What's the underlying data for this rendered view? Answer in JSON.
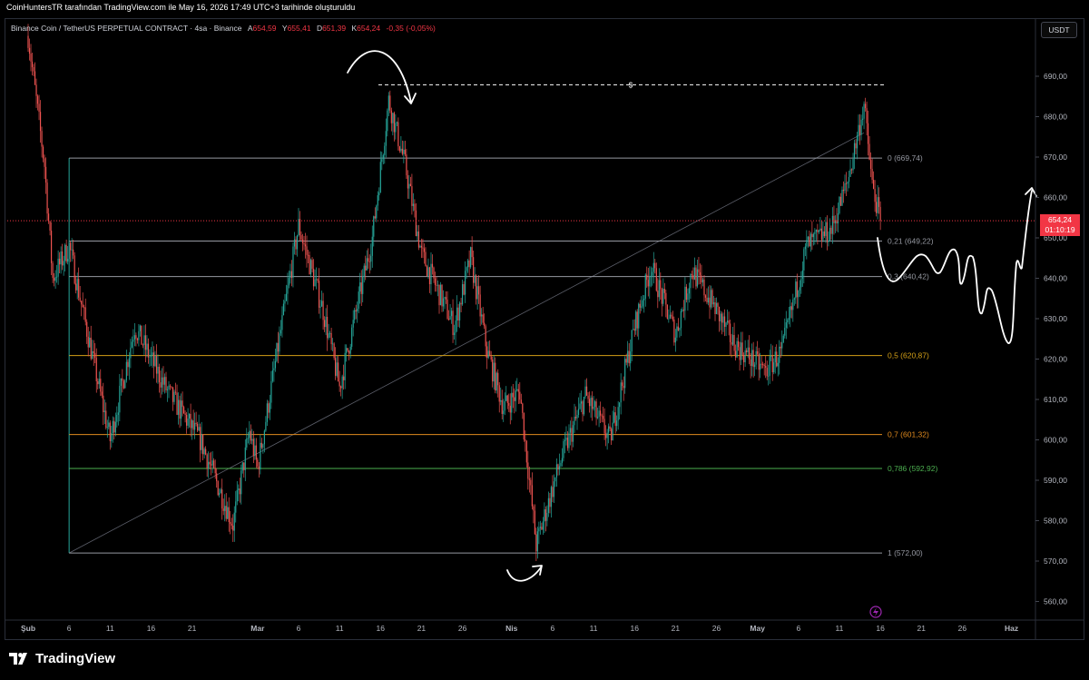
{
  "header": {
    "credit": "CoinHuntersTR tarafından TradingView.com ile May 16, 2026 17:49 UTC+3 tarihinde oluşturuldu"
  },
  "legend": {
    "symbol": "Binance Coin / TetherUS PERPETUAL CONTRACT · 4sa · Binance",
    "open_key": "A",
    "open": "654,59",
    "high_key": "Y",
    "high": "655,41",
    "low_key": "D",
    "low": "651,39",
    "close_key": "K",
    "close": "654,24",
    "change": "-0,35 (-0,05%)"
  },
  "currency_button": "USDT",
  "price_tag": {
    "price": "654,24",
    "countdown": "01:10:19"
  },
  "footer": {
    "brand": "TradingView"
  },
  "icons": {
    "logo": "tradingview-logo-icon",
    "lightning": "lightning-icon"
  },
  "colors": {
    "background": "#000000",
    "bull": "#26a69a",
    "bear": "#ef5350",
    "price_line": "#f23645",
    "fib_gray": "#9598a1",
    "fib_gold": "#d4a017",
    "fib_orange": "#e08a1e",
    "fib_green": "#4caf50"
  },
  "chart_data": {
    "type": "candlestick",
    "price_axis": {
      "labels": [
        "690,00",
        "680,00",
        "670,00",
        "660,00",
        "650,00",
        "640,00",
        "630,00",
        "620,00",
        "610,00",
        "600,00",
        "590,00",
        "580,00",
        "570,00",
        "560,00"
      ],
      "range": [
        555,
        696
      ]
    },
    "time_axis": {
      "labels": [
        "Şub",
        "6",
        "11",
        "16",
        "21",
        "Mar",
        "6",
        "11",
        "16",
        "21",
        "26",
        "Nis",
        "6",
        "11",
        "16",
        "21",
        "26",
        "May",
        "6",
        "11",
        "16",
        "21",
        "26",
        "Haz"
      ]
    },
    "fib_levels": [
      {
        "ratio": 0,
        "price": 669.74,
        "label": "0 (669,74)",
        "color": "#9598a1"
      },
      {
        "ratio": 0.21,
        "price": 649.22,
        "label": "0,21 (649,22)",
        "color": "#9598a1"
      },
      {
        "ratio": 0.3,
        "price": 640.42,
        "label": "0,3 (640,42)",
        "color": "#9598a1"
      },
      {
        "ratio": 0.5,
        "price": 620.87,
        "label": "0,5 (620,87)",
        "color": "#d4a017"
      },
      {
        "ratio": 0.7,
        "price": 601.32,
        "label": "0,7 (601,32)",
        "color": "#e08a1e"
      },
      {
        "ratio": 0.786,
        "price": 592.92,
        "label": "0,786 (592,92)",
        "color": "#4caf50"
      },
      {
        "ratio": 1,
        "price": 572.0,
        "label": "1 (572,00)",
        "color": "#9598a1"
      }
    ],
    "current_price": 654.24,
    "horizontal_ray": {
      "price": 687.9,
      "label": "$"
    },
    "anchors": [
      {
        "date": "Şub 1",
        "price": 700
      },
      {
        "date": "Şub 3",
        "price": 668
      },
      {
        "date": "Şub 4",
        "price": 640
      },
      {
        "date": "Şub 6",
        "price": 648
      },
      {
        "date": "Şub 11",
        "price": 600
      },
      {
        "date": "Şub 14",
        "price": 628
      },
      {
        "date": "Şub 18",
        "price": 612
      },
      {
        "date": "Şub 22",
        "price": 600
      },
      {
        "date": "Şub 26",
        "price": 579
      },
      {
        "date": "Şub 28",
        "price": 602
      },
      {
        "date": "Mar 1",
        "price": 593
      },
      {
        "date": "Mar 6",
        "price": 653
      },
      {
        "date": "Mar 9",
        "price": 632
      },
      {
        "date": "Mar 11",
        "price": 613
      },
      {
        "date": "Mar 15",
        "price": 650
      },
      {
        "date": "Mar 17",
        "price": 684
      },
      {
        "date": "Mar 19",
        "price": 668
      },
      {
        "date": "Mar 21",
        "price": 646
      },
      {
        "date": "Mar 25",
        "price": 628
      },
      {
        "date": "Mar 27",
        "price": 645
      },
      {
        "date": "Mar 29",
        "price": 622
      },
      {
        "date": "Mar 31",
        "price": 608
      },
      {
        "date": "Nis 2",
        "price": 612
      },
      {
        "date": "Nis 4",
        "price": 574
      },
      {
        "date": "Nis 7",
        "price": 595
      },
      {
        "date": "Nis 10",
        "price": 611
      },
      {
        "date": "Nis 13",
        "price": 600
      },
      {
        "date": "Nis 16",
        "price": 628
      },
      {
        "date": "Nis 18",
        "price": 643
      },
      {
        "date": "Nis 21",
        "price": 626
      },
      {
        "date": "Nis 23",
        "price": 642
      },
      {
        "date": "Nis 26",
        "price": 632
      },
      {
        "date": "Nis 28",
        "price": 624
      },
      {
        "date": "May 2",
        "price": 617
      },
      {
        "date": "May 4",
        "price": 622
      },
      {
        "date": "May 7",
        "price": 648
      },
      {
        "date": "May 10",
        "price": 652
      },
      {
        "date": "May 12",
        "price": 664
      },
      {
        "date": "May 14",
        "price": 683
      },
      {
        "date": "May 15",
        "price": 663
      },
      {
        "date": "May 16",
        "price": 654.24
      }
    ]
  }
}
